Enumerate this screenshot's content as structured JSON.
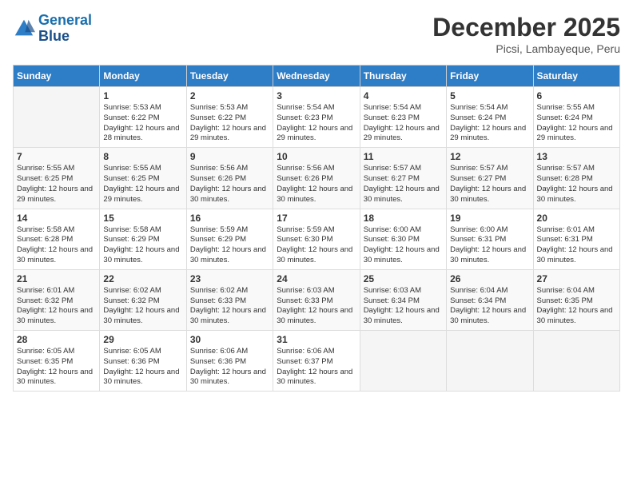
{
  "header": {
    "logo_line1": "General",
    "logo_line2": "Blue",
    "title": "December 2025",
    "subtitle": "Picsi, Lambayeque, Peru"
  },
  "weekdays": [
    "Sunday",
    "Monday",
    "Tuesday",
    "Wednesday",
    "Thursday",
    "Friday",
    "Saturday"
  ],
  "weeks": [
    [
      {
        "day": "",
        "sunrise": "",
        "sunset": "",
        "daylight": ""
      },
      {
        "day": "1",
        "sunrise": "Sunrise: 5:53 AM",
        "sunset": "Sunset: 6:22 PM",
        "daylight": "Daylight: 12 hours and 28 minutes."
      },
      {
        "day": "2",
        "sunrise": "Sunrise: 5:53 AM",
        "sunset": "Sunset: 6:22 PM",
        "daylight": "Daylight: 12 hours and 29 minutes."
      },
      {
        "day": "3",
        "sunrise": "Sunrise: 5:54 AM",
        "sunset": "Sunset: 6:23 PM",
        "daylight": "Daylight: 12 hours and 29 minutes."
      },
      {
        "day": "4",
        "sunrise": "Sunrise: 5:54 AM",
        "sunset": "Sunset: 6:23 PM",
        "daylight": "Daylight: 12 hours and 29 minutes."
      },
      {
        "day": "5",
        "sunrise": "Sunrise: 5:54 AM",
        "sunset": "Sunset: 6:24 PM",
        "daylight": "Daylight: 12 hours and 29 minutes."
      },
      {
        "day": "6",
        "sunrise": "Sunrise: 5:55 AM",
        "sunset": "Sunset: 6:24 PM",
        "daylight": "Daylight: 12 hours and 29 minutes."
      }
    ],
    [
      {
        "day": "7",
        "sunrise": "Sunrise: 5:55 AM",
        "sunset": "Sunset: 6:25 PM",
        "daylight": "Daylight: 12 hours and 29 minutes."
      },
      {
        "day": "8",
        "sunrise": "Sunrise: 5:55 AM",
        "sunset": "Sunset: 6:25 PM",
        "daylight": "Daylight: 12 hours and 29 minutes."
      },
      {
        "day": "9",
        "sunrise": "Sunrise: 5:56 AM",
        "sunset": "Sunset: 6:26 PM",
        "daylight": "Daylight: 12 hours and 30 minutes."
      },
      {
        "day": "10",
        "sunrise": "Sunrise: 5:56 AM",
        "sunset": "Sunset: 6:26 PM",
        "daylight": "Daylight: 12 hours and 30 minutes."
      },
      {
        "day": "11",
        "sunrise": "Sunrise: 5:57 AM",
        "sunset": "Sunset: 6:27 PM",
        "daylight": "Daylight: 12 hours and 30 minutes."
      },
      {
        "day": "12",
        "sunrise": "Sunrise: 5:57 AM",
        "sunset": "Sunset: 6:27 PM",
        "daylight": "Daylight: 12 hours and 30 minutes."
      },
      {
        "day": "13",
        "sunrise": "Sunrise: 5:57 AM",
        "sunset": "Sunset: 6:28 PM",
        "daylight": "Daylight: 12 hours and 30 minutes."
      }
    ],
    [
      {
        "day": "14",
        "sunrise": "Sunrise: 5:58 AM",
        "sunset": "Sunset: 6:28 PM",
        "daylight": "Daylight: 12 hours and 30 minutes."
      },
      {
        "day": "15",
        "sunrise": "Sunrise: 5:58 AM",
        "sunset": "Sunset: 6:29 PM",
        "daylight": "Daylight: 12 hours and 30 minutes."
      },
      {
        "day": "16",
        "sunrise": "Sunrise: 5:59 AM",
        "sunset": "Sunset: 6:29 PM",
        "daylight": "Daylight: 12 hours and 30 minutes."
      },
      {
        "day": "17",
        "sunrise": "Sunrise: 5:59 AM",
        "sunset": "Sunset: 6:30 PM",
        "daylight": "Daylight: 12 hours and 30 minutes."
      },
      {
        "day": "18",
        "sunrise": "Sunrise: 6:00 AM",
        "sunset": "Sunset: 6:30 PM",
        "daylight": "Daylight: 12 hours and 30 minutes."
      },
      {
        "day": "19",
        "sunrise": "Sunrise: 6:00 AM",
        "sunset": "Sunset: 6:31 PM",
        "daylight": "Daylight: 12 hours and 30 minutes."
      },
      {
        "day": "20",
        "sunrise": "Sunrise: 6:01 AM",
        "sunset": "Sunset: 6:31 PM",
        "daylight": "Daylight: 12 hours and 30 minutes."
      }
    ],
    [
      {
        "day": "21",
        "sunrise": "Sunrise: 6:01 AM",
        "sunset": "Sunset: 6:32 PM",
        "daylight": "Daylight: 12 hours and 30 minutes."
      },
      {
        "day": "22",
        "sunrise": "Sunrise: 6:02 AM",
        "sunset": "Sunset: 6:32 PM",
        "daylight": "Daylight: 12 hours and 30 minutes."
      },
      {
        "day": "23",
        "sunrise": "Sunrise: 6:02 AM",
        "sunset": "Sunset: 6:33 PM",
        "daylight": "Daylight: 12 hours and 30 minutes."
      },
      {
        "day": "24",
        "sunrise": "Sunrise: 6:03 AM",
        "sunset": "Sunset: 6:33 PM",
        "daylight": "Daylight: 12 hours and 30 minutes."
      },
      {
        "day": "25",
        "sunrise": "Sunrise: 6:03 AM",
        "sunset": "Sunset: 6:34 PM",
        "daylight": "Daylight: 12 hours and 30 minutes."
      },
      {
        "day": "26",
        "sunrise": "Sunrise: 6:04 AM",
        "sunset": "Sunset: 6:34 PM",
        "daylight": "Daylight: 12 hours and 30 minutes."
      },
      {
        "day": "27",
        "sunrise": "Sunrise: 6:04 AM",
        "sunset": "Sunset: 6:35 PM",
        "daylight": "Daylight: 12 hours and 30 minutes."
      }
    ],
    [
      {
        "day": "28",
        "sunrise": "Sunrise: 6:05 AM",
        "sunset": "Sunset: 6:35 PM",
        "daylight": "Daylight: 12 hours and 30 minutes."
      },
      {
        "day": "29",
        "sunrise": "Sunrise: 6:05 AM",
        "sunset": "Sunset: 6:36 PM",
        "daylight": "Daylight: 12 hours and 30 minutes."
      },
      {
        "day": "30",
        "sunrise": "Sunrise: 6:06 AM",
        "sunset": "Sunset: 6:36 PM",
        "daylight": "Daylight: 12 hours and 30 minutes."
      },
      {
        "day": "31",
        "sunrise": "Sunrise: 6:06 AM",
        "sunset": "Sunset: 6:37 PM",
        "daylight": "Daylight: 12 hours and 30 minutes."
      },
      {
        "day": "",
        "sunrise": "",
        "sunset": "",
        "daylight": ""
      },
      {
        "day": "",
        "sunrise": "",
        "sunset": "",
        "daylight": ""
      },
      {
        "day": "",
        "sunrise": "",
        "sunset": "",
        "daylight": ""
      }
    ]
  ]
}
